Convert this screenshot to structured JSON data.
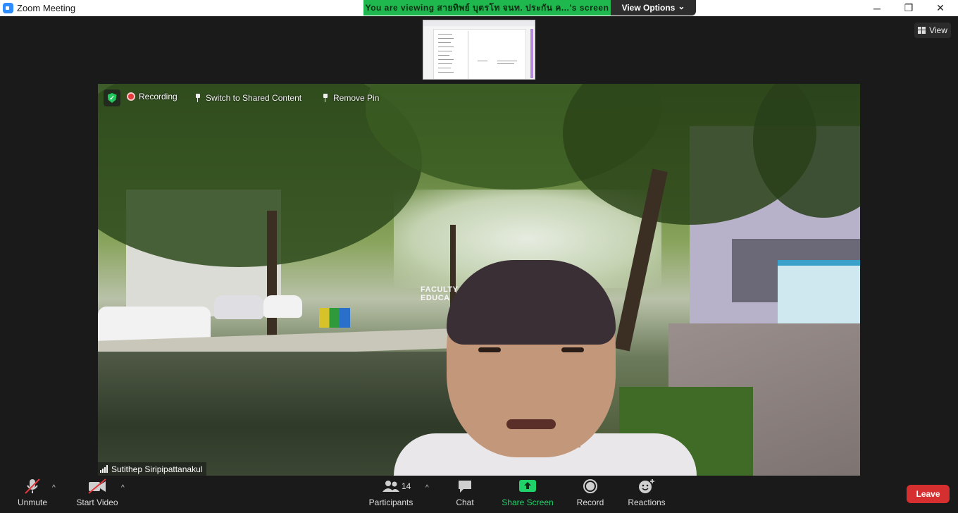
{
  "window": {
    "title": "Zoom Meeting",
    "minimize": "─",
    "restore": "❐",
    "close": "✕"
  },
  "banner": {
    "viewing_text": "You are viewing สายทิพย์ บุตรโท จนท. ประกัน ค...'s screen",
    "view_options": "View Options",
    "view_options_chevron": "⌄"
  },
  "view_button": {
    "label": "View",
    "icon": "grid-icon"
  },
  "video_overlay": {
    "recording_label": "Recording",
    "switch_label": "Switch to Shared Content",
    "remove_pin_label": "Remove Pin",
    "participant_name": "Sutithep Siripipattanakul",
    "sign_text": "FACULTY OF\nEDUCA"
  },
  "toolbar": {
    "unmute": "Unmute",
    "start_video": "Start Video",
    "participants": "Participants",
    "participants_count": "14",
    "chat": "Chat",
    "share_screen": "Share Screen",
    "record": "Record",
    "reactions": "Reactions",
    "leave": "Leave",
    "caret": "^"
  },
  "colors": {
    "share_green": "#1fb84f",
    "leave_red": "#d5302f",
    "share_screen_text": "#1fd36a"
  }
}
